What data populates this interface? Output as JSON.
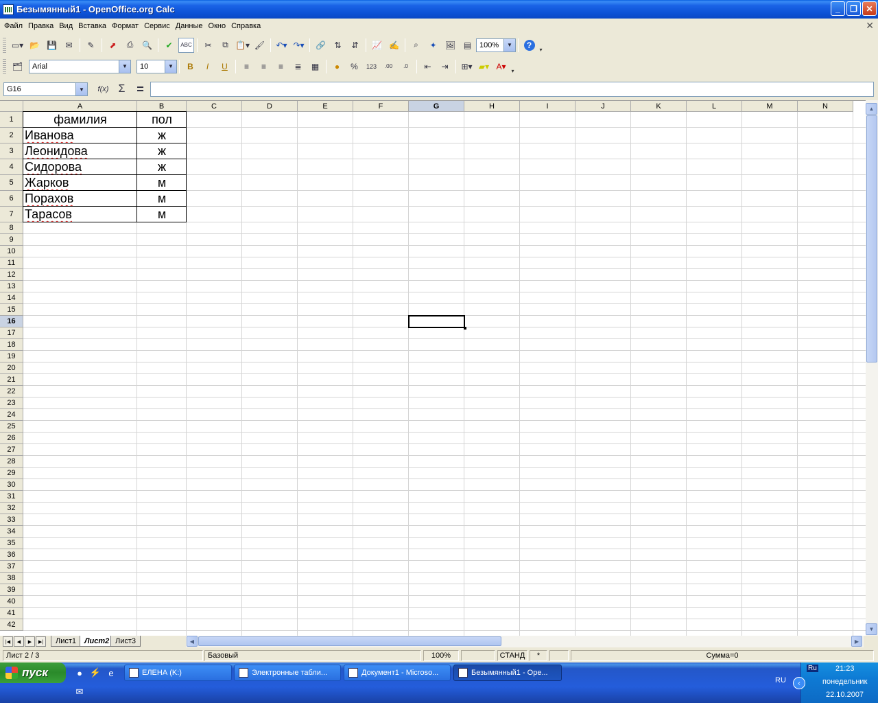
{
  "window": {
    "title": "Безымянный1 - OpenOffice.org Calc"
  },
  "menu": [
    "Файл",
    "Правка",
    "Вид",
    "Вставка",
    "Формат",
    "Сервис",
    "Данные",
    "Окно",
    "Справка"
  ],
  "toolbar": {
    "zoom": "100%"
  },
  "format_toolbar": {
    "font_name": "Arial",
    "font_size": "10"
  },
  "formula_bar": {
    "cell_ref": "G16",
    "formula": ""
  },
  "columns": [
    "A",
    "B",
    "C",
    "D",
    "E",
    "F",
    "G",
    "H",
    "I",
    "J",
    "K",
    "L",
    "M",
    "N"
  ],
  "rows": [
    "1",
    "2",
    "3",
    "4",
    "5",
    "6",
    "7",
    "8",
    "9",
    "10",
    "11",
    "12",
    "13",
    "14",
    "15",
    "16",
    "17",
    "18",
    "19",
    "20",
    "21",
    "22",
    "23",
    "24",
    "25",
    "26",
    "27",
    "28",
    "29",
    "30",
    "31",
    "32",
    "33",
    "34",
    "35",
    "36",
    "37",
    "38",
    "39",
    "40",
    "41",
    "42"
  ],
  "sheet": {
    "header": [
      "фамилия",
      "пол"
    ],
    "records": [
      [
        "Иванова",
        "ж"
      ],
      [
        "Леонидова",
        "ж"
      ],
      [
        "Сидорова",
        "ж"
      ],
      [
        "Жарков",
        "м"
      ],
      [
        "Порахов",
        "м"
      ],
      [
        "Тарасов",
        "м"
      ]
    ]
  },
  "sheet_tabs": [
    "Лист1",
    "Лист2",
    "Лист3"
  ],
  "active_sheet": "Лист2",
  "statusbar": {
    "sheet": "Лист 2 / 3",
    "style": "Базовый",
    "zoom": "100%",
    "mode": "СТАНД",
    "modified": "*",
    "sum": "Сумма=0"
  },
  "taskbar": {
    "start": "пуск",
    "tasks": [
      "ЕЛЕНА (K:)",
      "Электронные табли...",
      "Документ1 - Microso...",
      "Безымянный1 - Ope..."
    ],
    "lang_indicator": "Ru",
    "lang": "RU",
    "time": "21:23",
    "day": "понедельник",
    "date": "22.10.2007"
  }
}
